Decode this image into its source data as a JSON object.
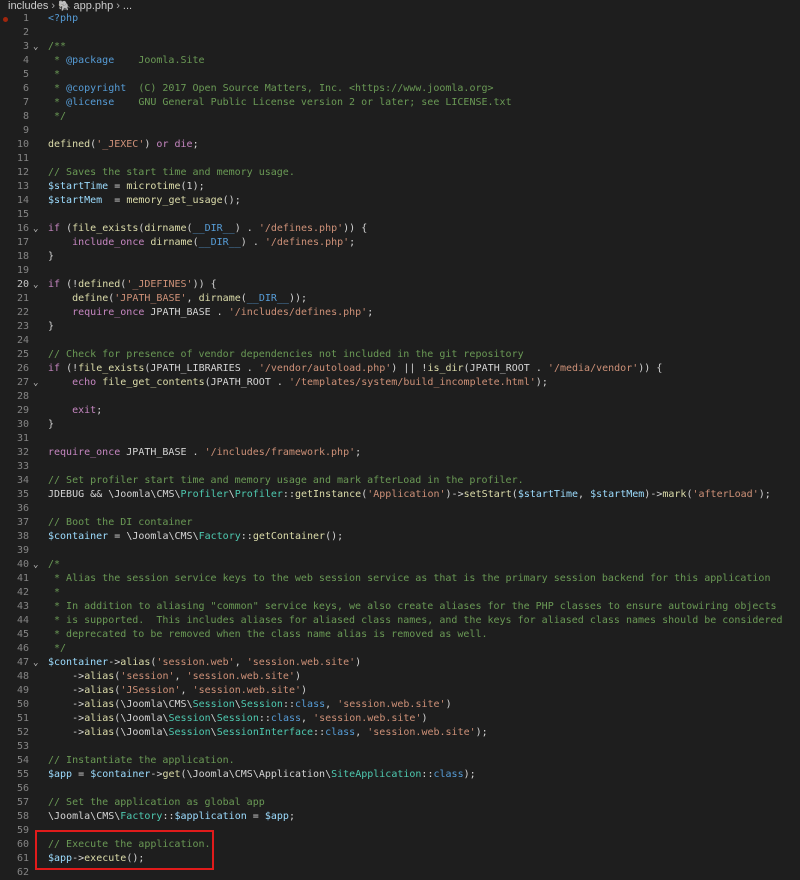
{
  "breadcrumb": {
    "folder": "includes",
    "file": "app.php",
    "more": "..."
  },
  "active_line": 20,
  "breakpoint_line": 1,
  "fold_lines": [
    3,
    16,
    20,
    27,
    40,
    47
  ],
  "highlighted_lines": [
    60,
    61
  ],
  "lines": [
    "<?php",
    "",
    "/**",
    " * @package    Joomla.Site",
    " *",
    " * @copyright  (C) 2017 Open Source Matters, Inc. <https://www.joomla.org>",
    " * @license    GNU General Public License version 2 or later; see LICENSE.txt",
    " */",
    "",
    "defined('_JEXEC') or die;",
    "",
    "// Saves the start time and memory usage.",
    "$startTime = microtime(1);",
    "$startMem  = memory_get_usage();",
    "",
    "if (file_exists(dirname(__DIR__) . '/defines.php')) {",
    "    include_once dirname(__DIR__) . '/defines.php';",
    "}",
    "",
    "if (!defined('_JDEFINES')) {",
    "    define('JPATH_BASE', dirname(__DIR__));",
    "    require_once JPATH_BASE . '/includes/defines.php';",
    "}",
    "",
    "// Check for presence of vendor dependencies not included in the git repository",
    "if (!file_exists(JPATH_LIBRARIES . '/vendor/autoload.php') || !is_dir(JPATH_ROOT . '/media/vendor')) {",
    "    echo file_get_contents(JPATH_ROOT . '/templates/system/build_incomplete.html');",
    "",
    "    exit;",
    "}",
    "",
    "require_once JPATH_BASE . '/includes/framework.php';",
    "",
    "// Set profiler start time and memory usage and mark afterLoad in the profiler.",
    "JDEBUG && \\Joomla\\CMS\\Profiler\\Profiler::getInstance('Application')->setStart($startTime, $startMem)->mark('afterLoad');",
    "",
    "// Boot the DI container",
    "$container = \\Joomla\\CMS\\Factory::getContainer();",
    "",
    "/*",
    " * Alias the session service keys to the web session service as that is the primary session backend for this application",
    " *",
    " * In addition to aliasing \"common\" service keys, we also create aliases for the PHP classes to ensure autowiring objects",
    " * is supported.  This includes aliases for aliased class names, and the keys for aliased class names should be considered",
    " * deprecated to be removed when the class name alias is removed as well.",
    " */",
    "$container->alias('session.web', 'session.web.site')",
    "    ->alias('session', 'session.web.site')",
    "    ->alias('JSession', 'session.web.site')",
    "    ->alias(\\Joomla\\CMS\\Session\\Session::class, 'session.web.site')",
    "    ->alias(\\Joomla\\Session\\Session::class, 'session.web.site')",
    "    ->alias(\\Joomla\\Session\\SessionInterface::class, 'session.web.site');",
    "",
    "// Instantiate the application.",
    "$app = $container->get(\\Joomla\\CMS\\Application\\SiteApplication::class);",
    "",
    "// Set the application as global app",
    "\\Joomla\\CMS\\Factory::$application = $app;",
    "",
    "// Execute the application.",
    "$app->execute();",
    ""
  ]
}
